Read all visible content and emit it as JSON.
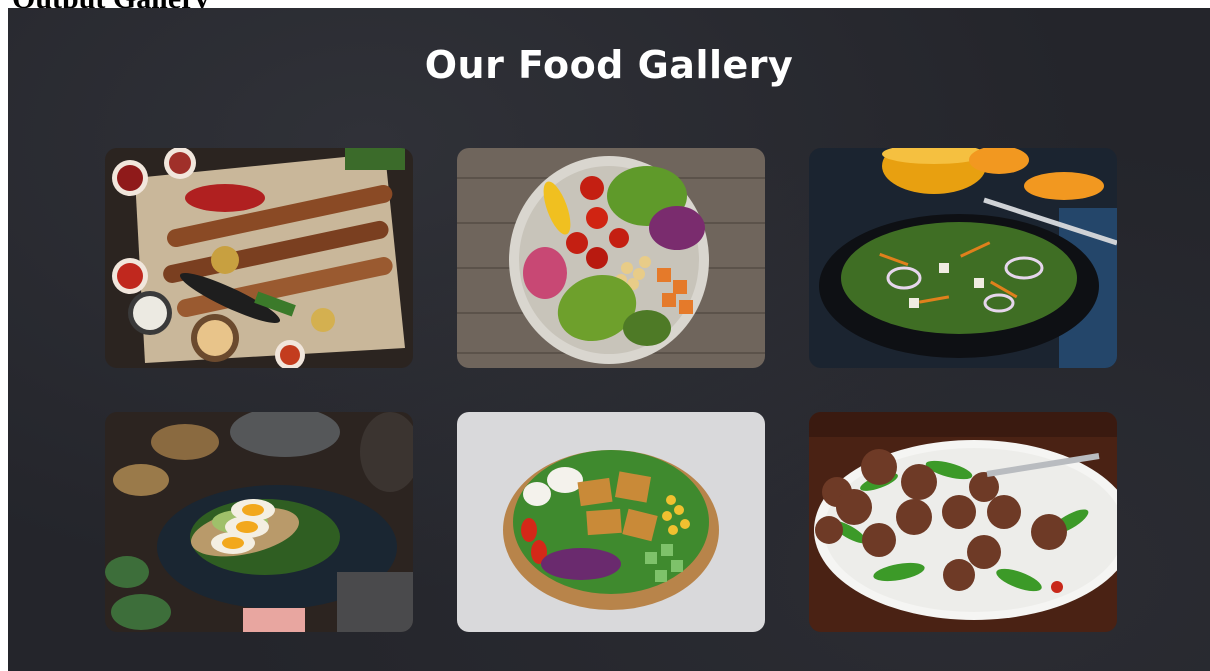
{
  "cropped_heading": "Output Gallery",
  "gallery": {
    "title": "Our Food Gallery",
    "items": [
      {
        "name": "grilled-kebab-platter"
      },
      {
        "name": "vegetable-chickpea-bowl"
      },
      {
        "name": "dark-plate-salad-with-juice"
      },
      {
        "name": "avocado-egg-toast"
      },
      {
        "name": "tofu-buddha-bowl"
      },
      {
        "name": "meatballs-with-arugula"
      }
    ]
  },
  "colors": {
    "page_background": "#24252b",
    "title_text": "#ffffff"
  }
}
